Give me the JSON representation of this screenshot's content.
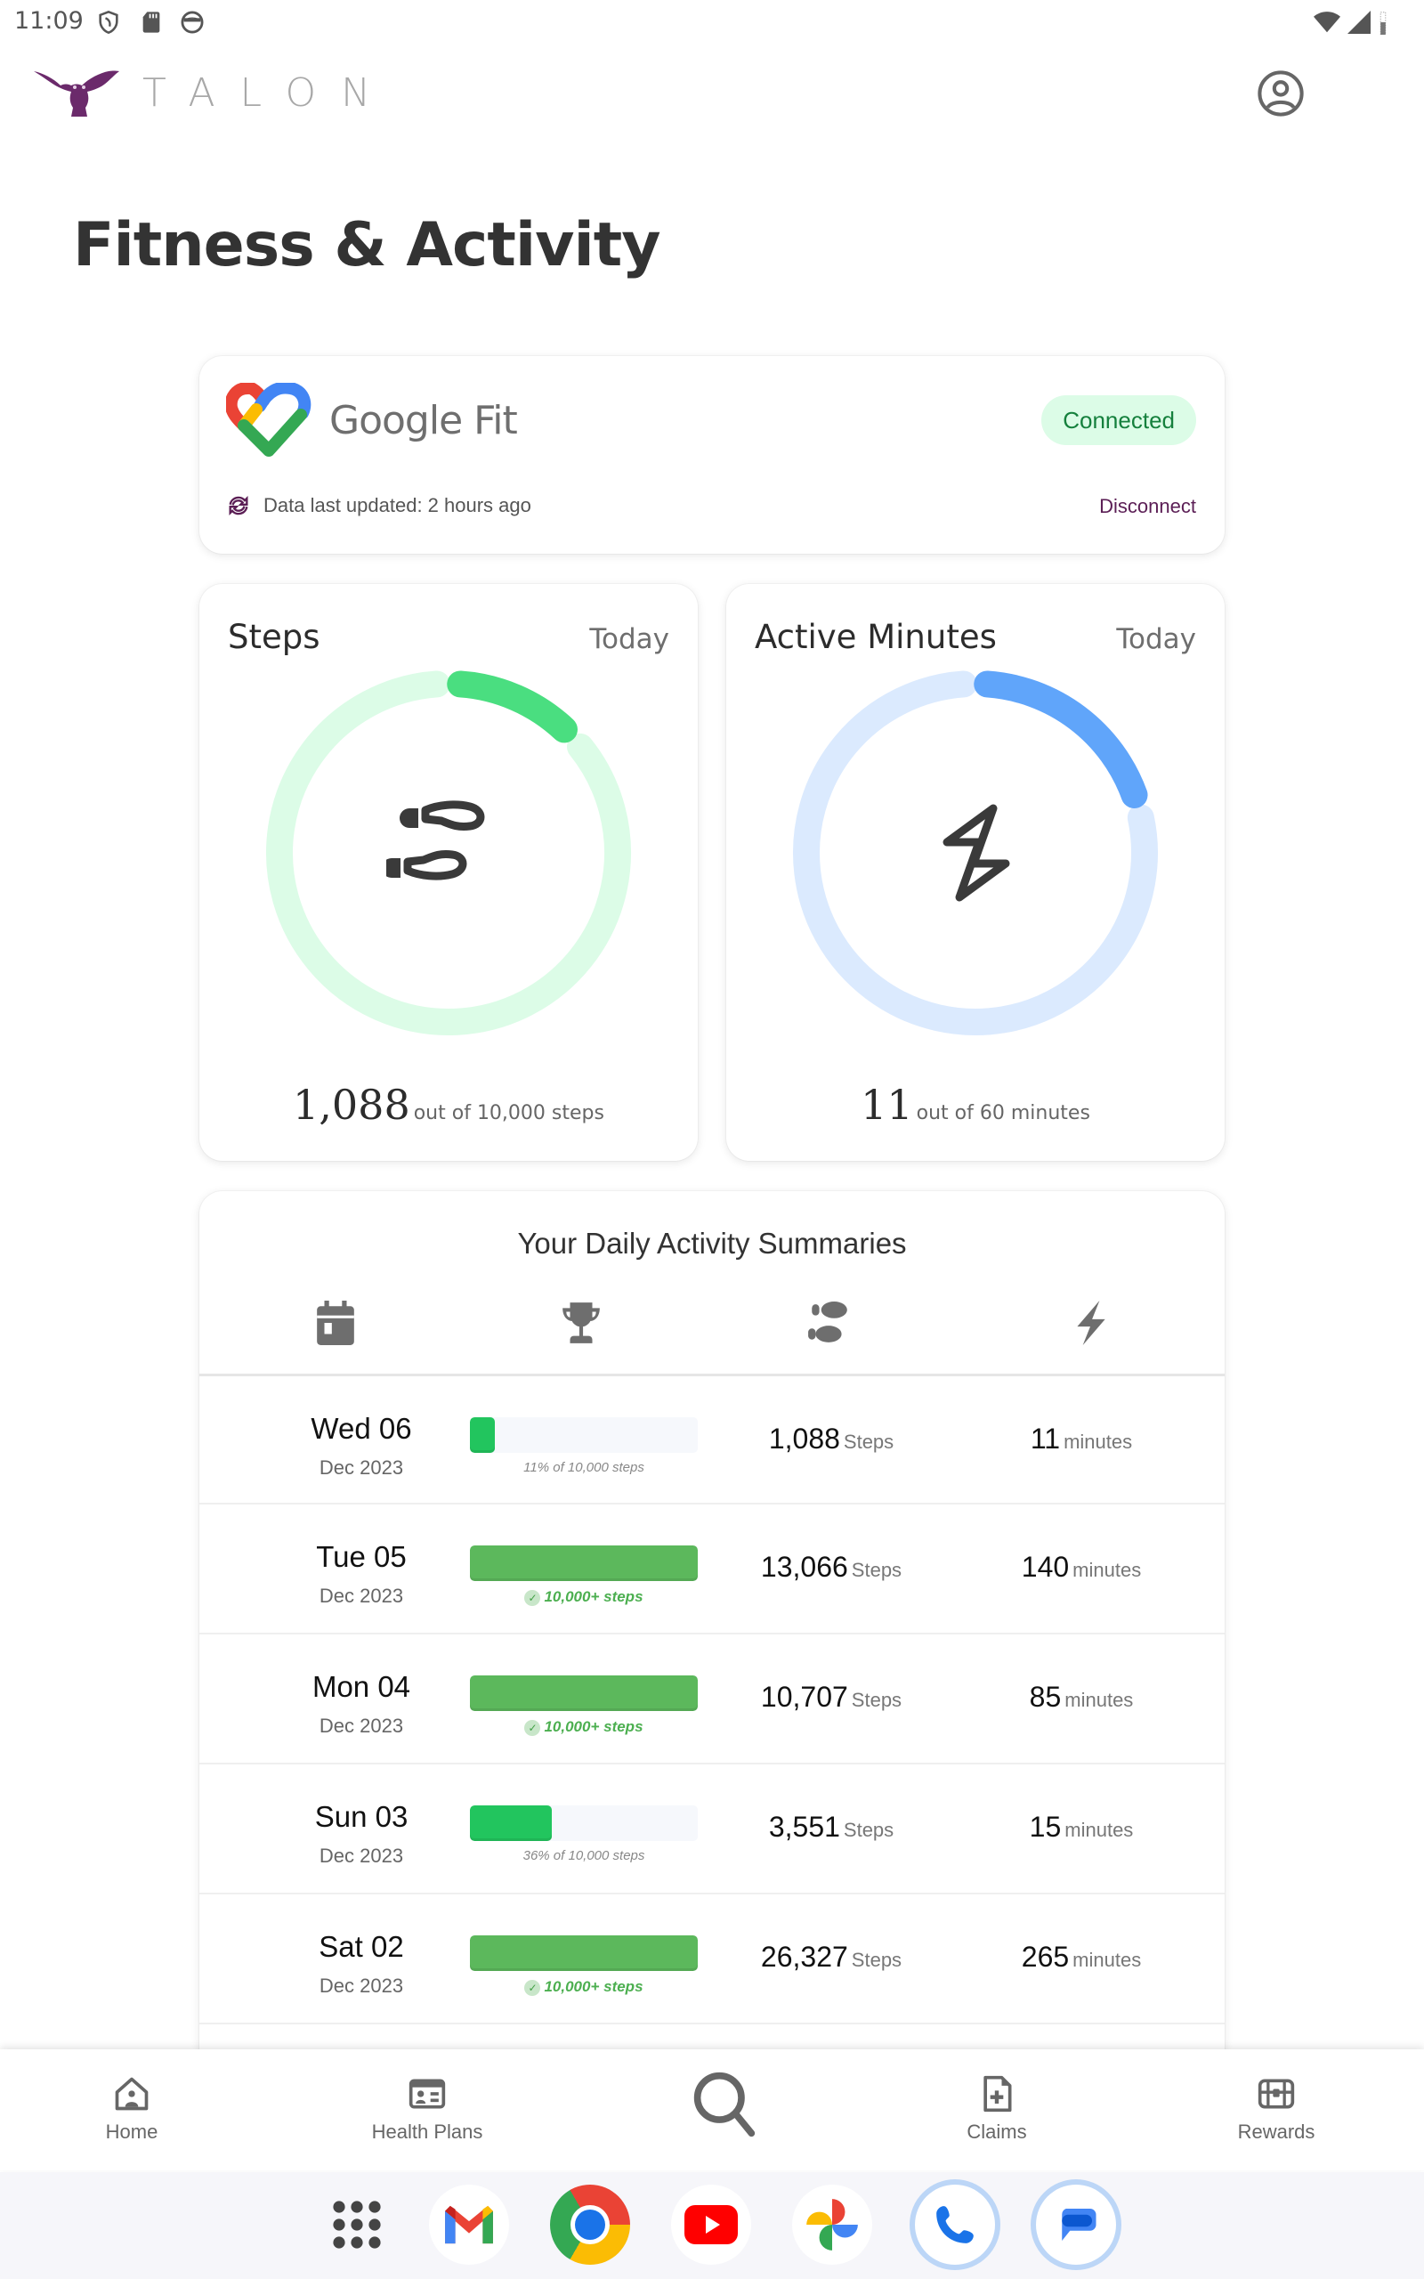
{
  "status_bar": {
    "time": "11:09",
    "left_icons": [
      "vpn-shield-icon",
      "sd-card-icon",
      "face-icon"
    ],
    "right_icons": [
      "wifi-icon",
      "cell-signal-icon",
      "battery-icon"
    ]
  },
  "header": {
    "brand": "TALON",
    "brand_color": "#6b2a6b",
    "profile_icon": "account-circle-icon"
  },
  "page": {
    "title": "Fitness & Activity"
  },
  "google_fit": {
    "name": "Google Fit",
    "status": "Connected",
    "last_updated": "Data last updated: 2 hours ago",
    "disconnect_label": "Disconnect"
  },
  "steps_card": {
    "title": "Steps",
    "period": "Today",
    "value": "1,088",
    "suffix": "out of 10,000 steps",
    "progress": 0.1088,
    "color": "#4ade80",
    "track_color": "#dcfce7"
  },
  "minutes_card": {
    "title": "Active Minutes",
    "period": "Today",
    "value": "11",
    "suffix": "out of 60 minutes",
    "progress": 0.1833,
    "color": "#60a5fa",
    "track_color": "#dbeafe"
  },
  "summary": {
    "title": "Your Daily Activity Summaries",
    "column_icons": [
      "calendar-icon",
      "trophy-icon",
      "footsteps-icon",
      "lightning-icon"
    ],
    "rows": [
      {
        "day": "Wed 06",
        "month": "Dec 2023",
        "progress": 0.11,
        "achieved": false,
        "caption": "11% of 10,000 steps",
        "steps": "1,088",
        "steps_unit": "Steps",
        "minutes": "11",
        "minutes_unit": "minutes"
      },
      {
        "day": "Tue 05",
        "month": "Dec 2023",
        "progress": 1.0,
        "achieved": true,
        "caption": "10,000+ steps",
        "steps": "13,066",
        "steps_unit": "Steps",
        "minutes": "140",
        "minutes_unit": "minutes"
      },
      {
        "day": "Mon 04",
        "month": "Dec 2023",
        "progress": 1.0,
        "achieved": true,
        "caption": "10,000+ steps",
        "steps": "10,707",
        "steps_unit": "Steps",
        "minutes": "85",
        "minutes_unit": "minutes"
      },
      {
        "day": "Sun 03",
        "month": "Dec 2023",
        "progress": 0.36,
        "achieved": false,
        "caption": "36% of 10,000 steps",
        "steps": "3,551",
        "steps_unit": "Steps",
        "minutes": "15",
        "minutes_unit": "minutes"
      },
      {
        "day": "Sat 02",
        "month": "Dec 2023",
        "progress": 1.0,
        "achieved": true,
        "caption": "10,000+ steps",
        "steps": "26,327",
        "steps_unit": "Steps",
        "minutes": "265",
        "minutes_unit": "minutes"
      }
    ]
  },
  "bottom_nav": {
    "items": [
      {
        "label": "Home",
        "icon": "home-icon"
      },
      {
        "label": "Health Plans",
        "icon": "id-card-icon"
      },
      {
        "label": "",
        "icon": "search-icon"
      },
      {
        "label": "Claims",
        "icon": "medical-document-icon"
      },
      {
        "label": "Rewards",
        "icon": "treasure-chest-icon"
      }
    ]
  },
  "dock": {
    "apps": [
      "app-drawer",
      "Gmail",
      "Chrome",
      "YouTube",
      "Photos",
      "Phone",
      "Messages"
    ]
  }
}
